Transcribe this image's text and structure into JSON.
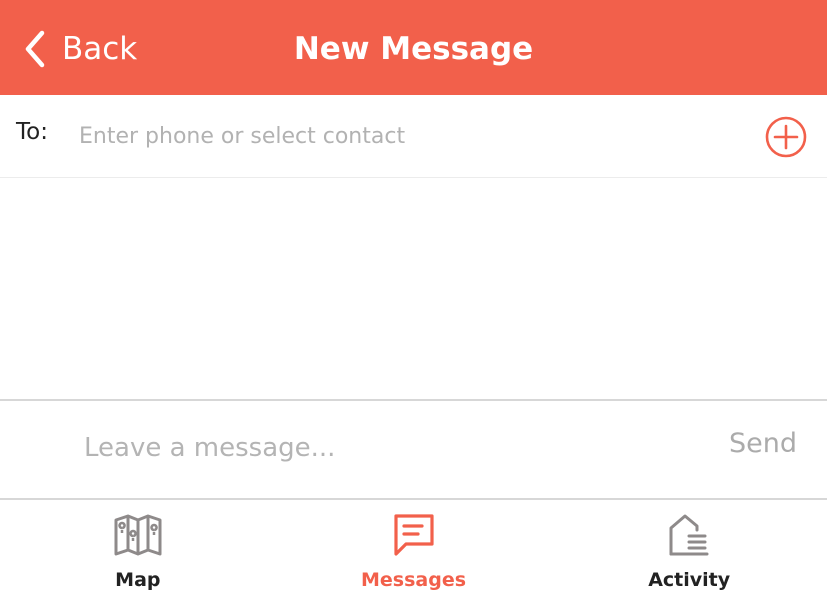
{
  "header": {
    "back_label": "Back",
    "title": "New Message",
    "background": "#f2604b"
  },
  "recipient": {
    "label": "To:",
    "placeholder": "Enter phone or select contact",
    "value": "",
    "add_icon": "plus-circle-icon"
  },
  "composer": {
    "placeholder": "Leave a message...",
    "value": "",
    "send_label": "Send"
  },
  "tabs": [
    {
      "label": "Map",
      "icon": "map-icon",
      "active": false
    },
    {
      "label": "Messages",
      "icon": "message-icon",
      "active": true
    },
    {
      "label": "Activity",
      "icon": "activity-icon",
      "active": false
    }
  ],
  "colors": {
    "accent": "#f2604b",
    "inactive_icon": "#8e8a8a",
    "inactive_label": "#222222"
  }
}
